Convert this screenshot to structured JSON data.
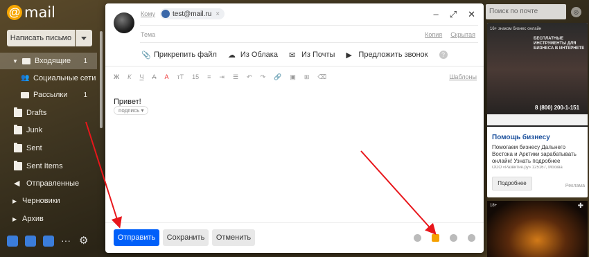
{
  "logo": {
    "at": "@",
    "text": "mail"
  },
  "sidebar": {
    "compose_label": "Написать письмо",
    "folders": [
      {
        "label": "Входящие",
        "count": "1"
      },
      {
        "label": "Социальные сети",
        "count": ""
      },
      {
        "label": "Рассылки",
        "count": "1"
      },
      {
        "label": "Drafts",
        "count": ""
      },
      {
        "label": "Junk",
        "count": ""
      },
      {
        "label": "Sent",
        "count": ""
      },
      {
        "label": "Sent Items",
        "count": ""
      },
      {
        "label": "Отправленные",
        "count": ""
      },
      {
        "label": "Черновики",
        "count": ""
      },
      {
        "label": "Архив",
        "count": ""
      }
    ],
    "more": "···"
  },
  "compose": {
    "to_label": "Кому",
    "recipient": "test@mail.ru",
    "recipient_remove": "×",
    "subject_label": "Тема",
    "copy_label": "Копия",
    "bcc_label": "Скрытая",
    "window_buttons": {
      "minimize": "–",
      "expand": "⤢",
      "close": "✕"
    },
    "attach": {
      "file": "Прикрепить файл",
      "cloud": "Из Облака",
      "mail": "Из Почты",
      "call": "Предложить звонок",
      "help": "?"
    },
    "format": {
      "bold": "Ж",
      "italic": "К",
      "underline": "Ч",
      "strike": "А",
      "color": "А",
      "size_icon": "тТ",
      "size": "15",
      "templates": "Шаблоны"
    },
    "body": "Привет!",
    "signature": "подпись ▾",
    "buttons": {
      "send": "Отправить",
      "save": "Сохранить",
      "cancel": "Отменить"
    }
  },
  "right": {
    "search_placeholder": "Поиск по почте",
    "ad": {
      "age": "16+",
      "top_line": "знаком бизнес онлайн",
      "headline": "БЕСПЛАТНЫЕ ИНСТРУМЕНТЫ ДЛЯ БИЗНЕСА В ИНТЕРНЕТЕ",
      "phone": "8 (800) 200-1-151",
      "title": "Помощь бизнесу",
      "description": "Помогаем бизнесу Дальнего Востока и Арктики зарабатывать онлайн! Узнать подробнее",
      "small": "ООО «Развитие.ру» 125167, Москва",
      "more_button": "Подробнее",
      "label": "Реклама"
    },
    "ad2": {
      "age": "18+",
      "plus": "✚"
    }
  },
  "colors": {
    "send": "#005ff9",
    "accent": "#f7a600",
    "arrow": "#e8161b"
  }
}
